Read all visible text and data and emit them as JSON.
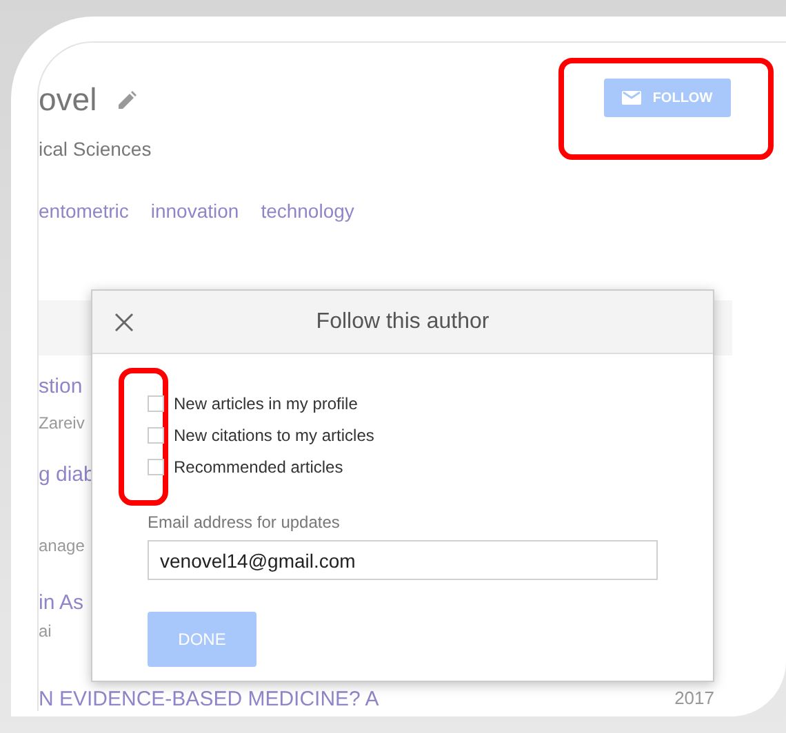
{
  "profile": {
    "name": "ovel",
    "affiliation": "ical Sciences",
    "interests": [
      "entometric",
      "innovation",
      "technology"
    ],
    "follow_button": "FOLLOW"
  },
  "articles": [
    {
      "title": "stion",
      "line_2": "Zareiv"
    },
    {
      "title": "g diab",
      "line_2": "anage"
    },
    {
      "title": "in As",
      "line_2": "ai"
    },
    {
      "title": "N EVIDENCE-BASED MEDICINE? A",
      "year": "2017"
    }
  ],
  "dialog": {
    "title": "Follow this author",
    "options": [
      {
        "label": "New articles in my profile",
        "checked": false
      },
      {
        "label": "New citations to my articles",
        "checked": false
      },
      {
        "label": "Recommended articles",
        "checked": false
      }
    ],
    "email_label": "Email address for updates",
    "email_value": "venovel14@gmail.com",
    "done_button": "DONE"
  }
}
